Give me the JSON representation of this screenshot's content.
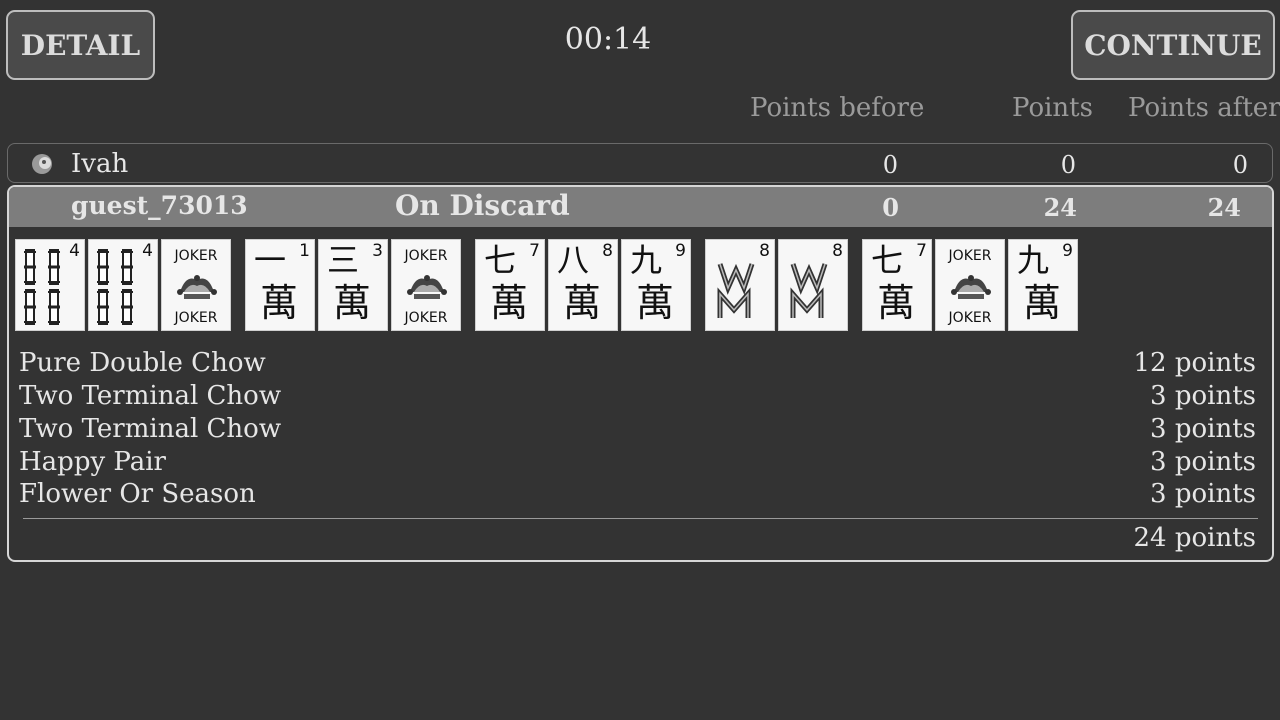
{
  "header": {
    "detail_label": "DETAIL",
    "continue_label": "CONTINUE",
    "timer": "00:14"
  },
  "columns": {
    "points_before": "Points before",
    "points": "Points",
    "points_after": "Points after"
  },
  "players": [
    {
      "name": "Ivah",
      "avatar_icon": "player-avatar-icon",
      "points_before": "0",
      "points": "0",
      "points_after": "0"
    },
    {
      "name": "guest_73013",
      "win_type": "On Discard",
      "points_before": "0",
      "points": "24",
      "points_after": "24"
    }
  ],
  "hand": {
    "tiles": [
      {
        "kind": "bamboo",
        "num": "4"
      },
      {
        "kind": "bamboo",
        "num": "4"
      },
      {
        "kind": "joker",
        "text_top": "JOKER",
        "text_bottom": "JOKER"
      },
      {
        "kind": "character",
        "top": "一",
        "bottom": "萬",
        "num": "1"
      },
      {
        "kind": "character",
        "top": "三",
        "bottom": "萬",
        "num": "3"
      },
      {
        "kind": "joker",
        "text_top": "JOKER",
        "text_bottom": "JOKER"
      },
      {
        "kind": "character",
        "top": "七",
        "bottom": "萬",
        "num": "7"
      },
      {
        "kind": "character",
        "top": "八",
        "bottom": "萬",
        "num": "8"
      },
      {
        "kind": "character",
        "top": "九",
        "bottom": "萬",
        "num": "9"
      },
      {
        "kind": "flower",
        "num": "8"
      },
      {
        "kind": "flower",
        "num": "8"
      },
      {
        "kind": "character",
        "top": "七",
        "bottom": "萬",
        "num": "7"
      },
      {
        "kind": "joker",
        "text_top": "JOKER",
        "text_bottom": "JOKER"
      },
      {
        "kind": "character",
        "top": "九",
        "bottom": "萬",
        "num": "9"
      }
    ]
  },
  "fans": [
    {
      "name": "Pure Double Chow",
      "points": "12 points"
    },
    {
      "name": "Two Terminal Chow",
      "points": "3 points"
    },
    {
      "name": "Two Terminal Chow",
      "points": "3 points"
    },
    {
      "name": "Happy Pair",
      "points": "3 points"
    },
    {
      "name": "Flower Or Season",
      "points": "3 points"
    }
  ],
  "total": "24 points",
  "colors": {
    "background": "#333333",
    "header_bar": "#7d7d7d",
    "tile": "#f7f7f7"
  }
}
